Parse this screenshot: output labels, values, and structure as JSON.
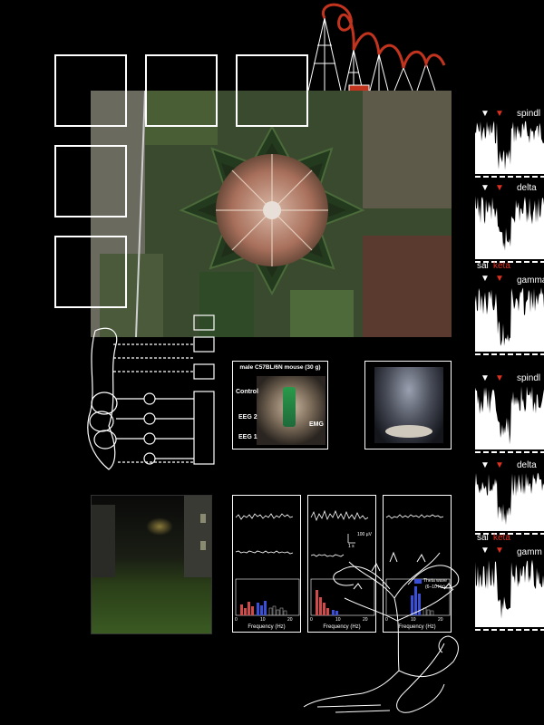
{
  "mouse_panel": {
    "title": "male C57BL/6N mouse (30 g)",
    "labels": {
      "control": "Control",
      "eeg2": "EEG 2",
      "eeg1": "EEG 1",
      "emg": "EMG"
    }
  },
  "traces": [
    {
      "left_label": "",
      "highlight_label": "",
      "right_label": "spindl"
    },
    {
      "left_label": "",
      "highlight_label": "",
      "right_label": "delta"
    },
    {
      "left_label": "sal",
      "highlight_label": "keta",
      "right_label": "gamma"
    },
    {
      "left_label": "",
      "highlight_label": "",
      "right_label": "spindl"
    },
    {
      "left_label": "",
      "highlight_label": "",
      "right_label": "delta"
    },
    {
      "left_label": "sal",
      "highlight_label": "keta",
      "right_label": "gamm"
    }
  ],
  "eeg_panels": {
    "scale_label": "100 µV",
    "time_label": "1 s",
    "theta_legend": "Theta wave",
    "theta_range": "(6–10 Hz)",
    "axis_label": "Frequency (Hz)",
    "ticks": [
      "0",
      "10",
      "20"
    ]
  },
  "colors": {
    "accent_red": "#e03020",
    "theta_blue": "#3a4fd8",
    "bar_red": "#d04a4a"
  }
}
